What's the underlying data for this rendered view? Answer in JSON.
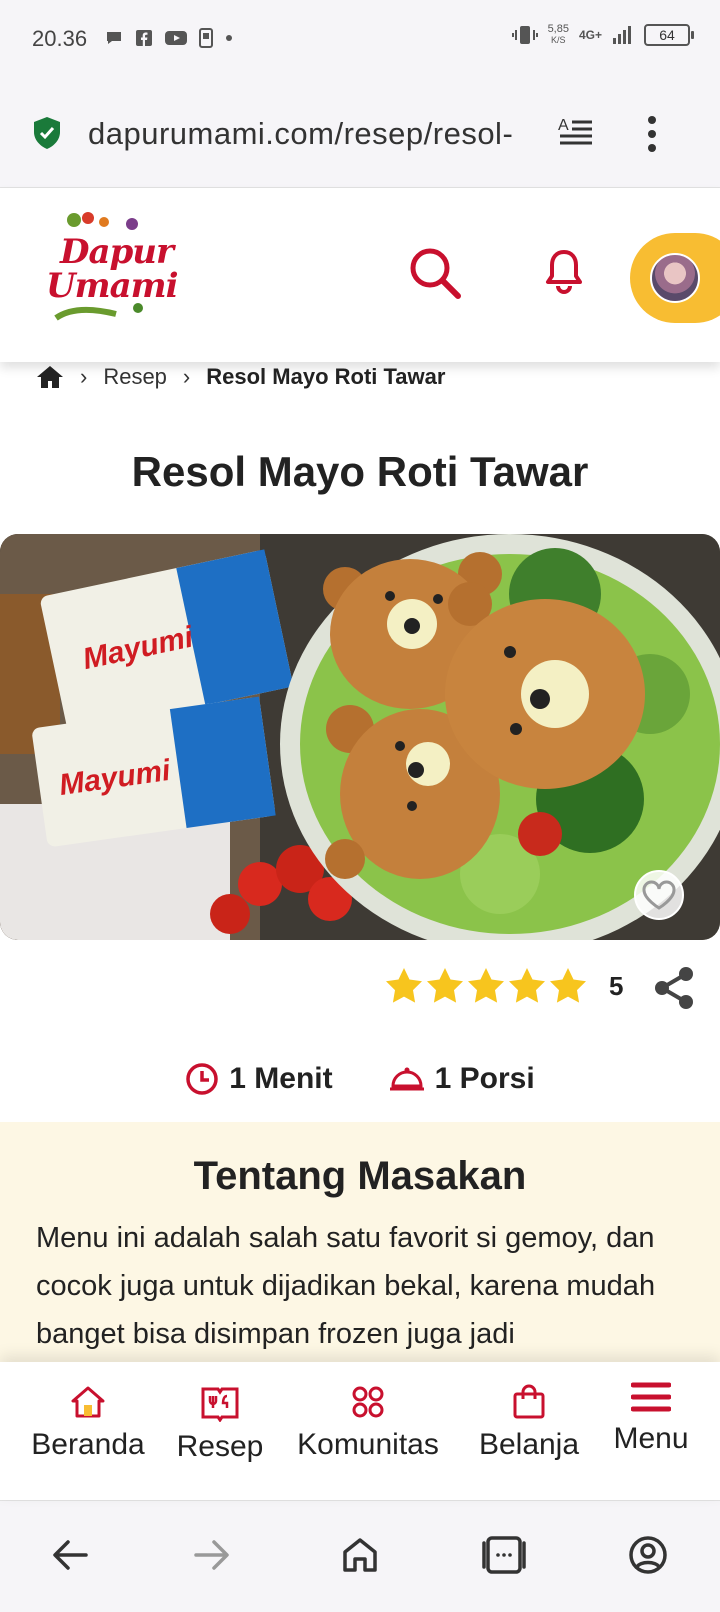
{
  "status_bar": {
    "time": "20.36",
    "net_speed_value": "5,85",
    "net_speed_unit": "K/S",
    "network": "4G+",
    "battery": "64"
  },
  "browser": {
    "url": "dapurumami.com/resep/resol-"
  },
  "site": {
    "logo_line1": "Dapur",
    "logo_line2": "Umami"
  },
  "breadcrumb": {
    "home_label": "Home",
    "items": [
      "Resep",
      "Resol Mayo Roti Tawar"
    ]
  },
  "recipe": {
    "title": "Resol Mayo Roti Tawar",
    "rating_value": "5",
    "rating_stars": 5,
    "duration": "1 Menit",
    "servings": "1 Porsi",
    "image_label": "Mayumi"
  },
  "about": {
    "title": "Tentang Masakan",
    "text": "Menu ini adalah salah satu favorit si gemoy, dan cocok juga untuk dijadikan bekal, karena mudah banget bisa disimpan frozen juga jadi"
  },
  "bottom_nav": {
    "items": [
      {
        "label": "Beranda",
        "icon": "home-icon"
      },
      {
        "label": "Resep",
        "icon": "recipe-book-icon"
      },
      {
        "label": "Komunitas",
        "icon": "community-icon"
      },
      {
        "label": "Belanja",
        "icon": "shopping-bag-icon"
      },
      {
        "label": "Menu",
        "icon": "hamburger-menu-icon"
      }
    ]
  },
  "colors": {
    "brand_red": "#c8102e",
    "accent_yellow": "#f8bd32",
    "star_yellow": "#f7c51e",
    "about_bg": "#fdf7e4"
  }
}
